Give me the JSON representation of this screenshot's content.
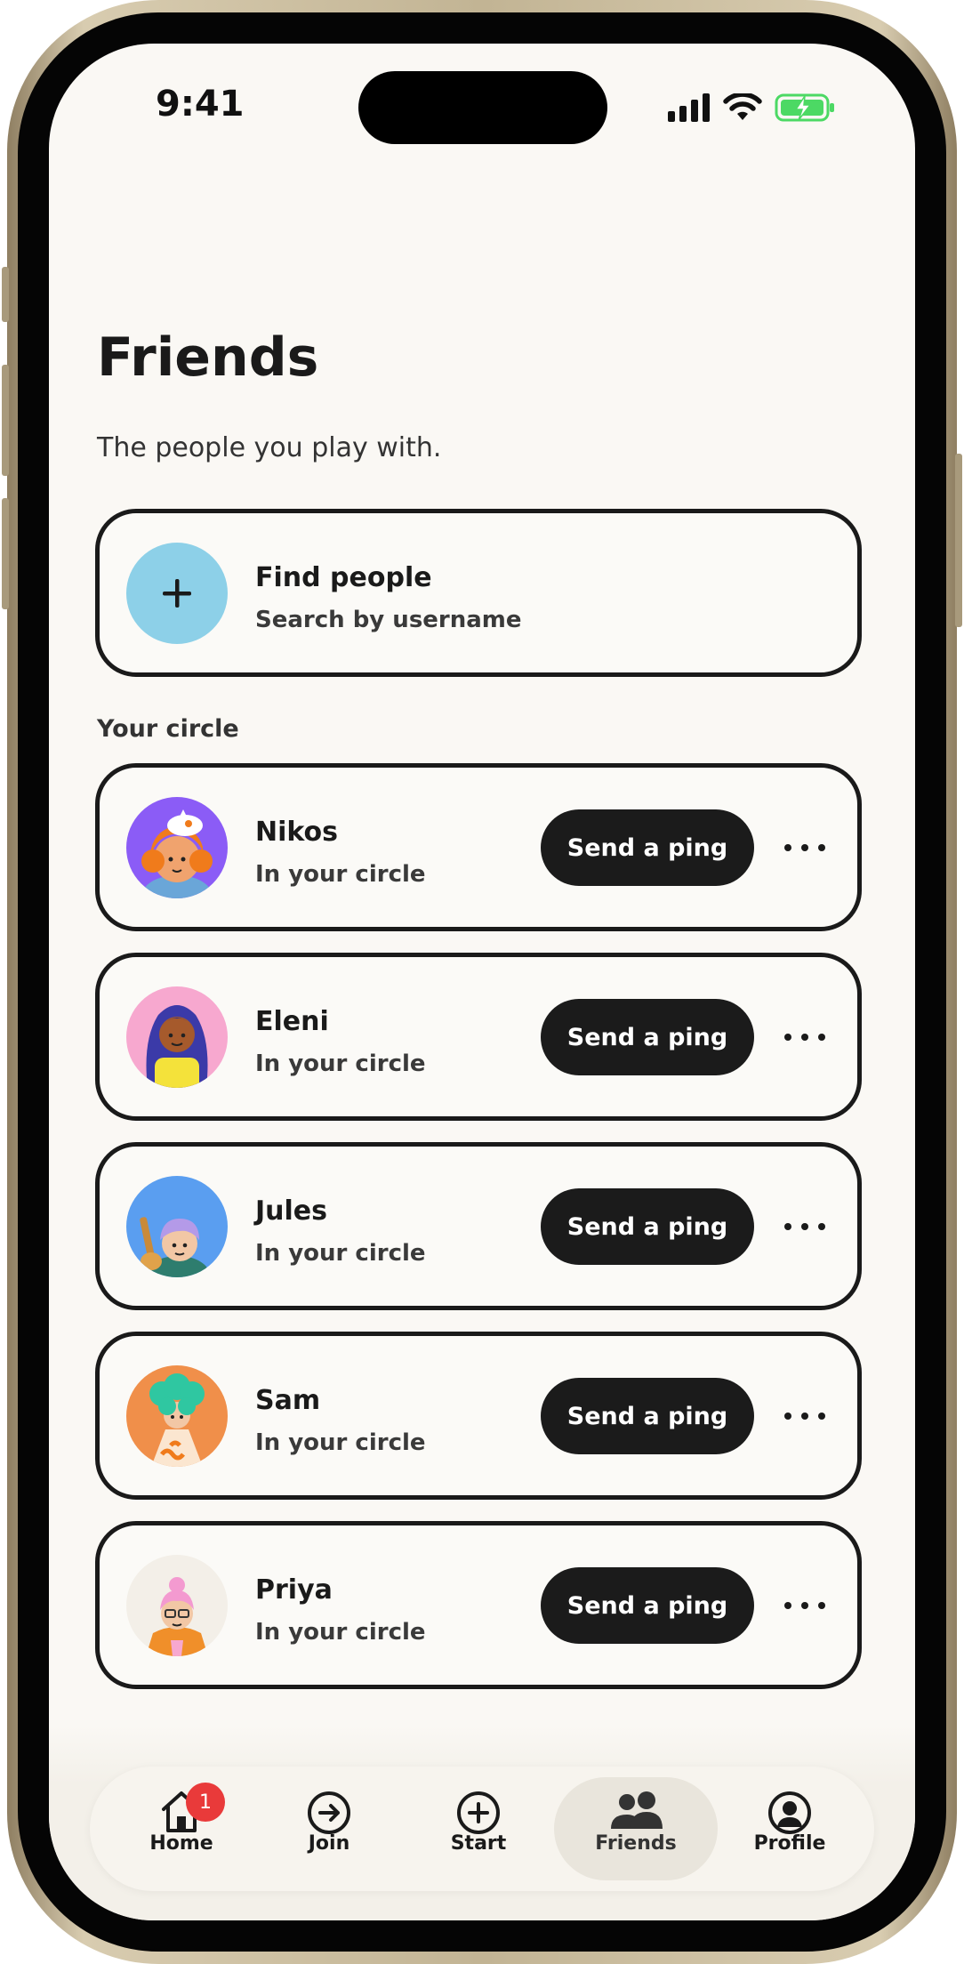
{
  "status_bar": {
    "time": "9:41"
  },
  "header": {
    "title": "Friends",
    "subtitle": "The people you play with."
  },
  "find_people": {
    "title": "Find people",
    "subtitle": "Search by username",
    "icon": "plus-icon",
    "icon_bg": "#8dd0e8"
  },
  "section": {
    "label": "Your circle"
  },
  "friends": [
    {
      "name": "Nikos",
      "status": "In your circle",
      "action": "Send a ping",
      "avatar_bg": "#8b5cf6"
    },
    {
      "name": "Eleni",
      "status": "In your circle",
      "action": "Send a ping",
      "avatar_bg": "#f7a8cf"
    },
    {
      "name": "Jules",
      "status": "In your circle",
      "action": "Send a ping",
      "avatar_bg": "#5a9ef0"
    },
    {
      "name": "Sam",
      "status": "In your circle",
      "action": "Send a ping",
      "avatar_bg": "#f08f4a"
    },
    {
      "name": "Priya",
      "status": "In your circle",
      "action": "Send a ping",
      "avatar_bg": "#f3efe8"
    }
  ],
  "tabs": [
    {
      "label": "Home",
      "icon": "home-icon",
      "badge": "1"
    },
    {
      "label": "Join",
      "icon": "arrow-right-circle-icon"
    },
    {
      "label": "Start",
      "icon": "plus-circle-icon"
    },
    {
      "label": "Friends",
      "icon": "people-icon",
      "active": true
    },
    {
      "label": "Profile",
      "icon": "person-circle-icon"
    }
  ],
  "colors": {
    "background": "#faf8f4",
    "card_border": "#1a1a1a",
    "button_dark": "#1b1b1b",
    "badge_red": "#e93a3a",
    "battery_green": "#4cd964"
  }
}
